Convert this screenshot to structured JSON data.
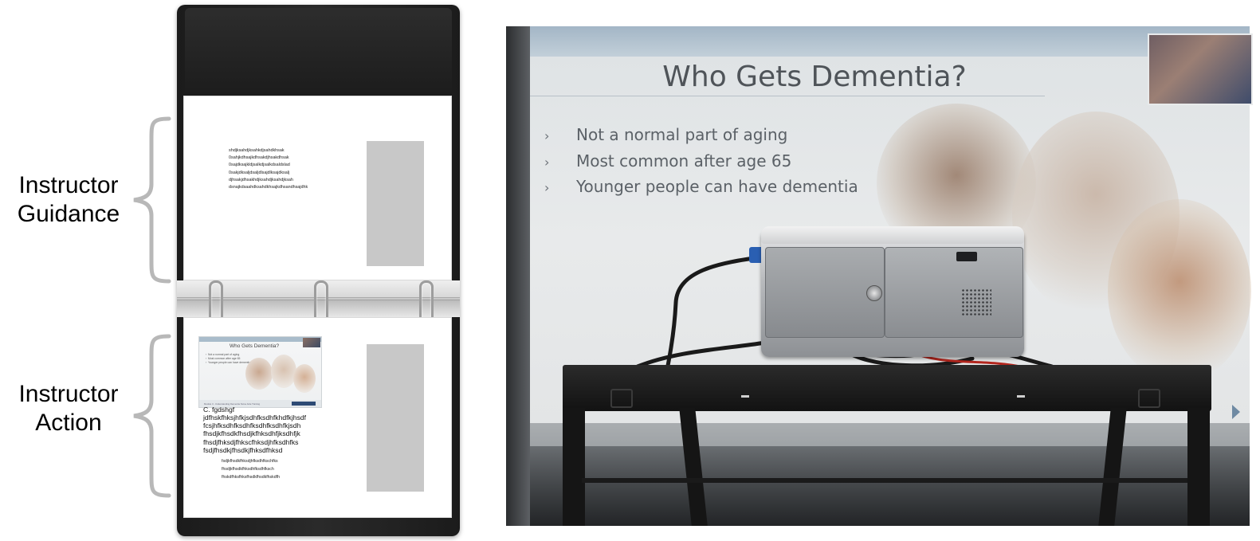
{
  "labels": {
    "guidance_line1": "Instructor",
    "guidance_line2": "Guidance",
    "action_line1": "Instructor",
    "action_line2": "Action"
  },
  "binder": {
    "top_page_text": "shdjksahdjksahkdjsahdkhsak\n0sahjkdhsajkdhsakdjhsakdhsak\n0sajdksajkldjsalkdjsalkdsaldslad\n0sakjdksaljdsaljdlsajdlksajdksalj\ndjhsakjdhsakhdjksahdjksahdjksah\ndsnajkdsaahdksahdkhsajkdhsandhsajdhk",
    "bottom_label": "C. fgdshgf",
    "bottom_body": "jdfhskfhksjhfkjsdhfksdhfkhdfkjhsdf\nfcsjhfksdhfksdhfksdhfksdhfkjsdh\nfhsdjkfhsdkfhsdjkfhksdhfjksdhfjk\nfhsdjfhksdjfhkscfhksdjhfksdhfks\nfsdjfhsdkjfhsdkjfhksdfhksd",
    "bottom_small": "fsdjkfhsdkfhksdjhfksdhfkschfks\nfhsdjkfhsdkfhksdhfksdhfksch\nfhskdfhksfhksfhsdkfhsdkfhskdfh",
    "mini_slide": {
      "title": "Who Gets Dementia?",
      "bullets": "›  Not a normal part of aging\n›  Most common after age 65\n›  Younger people can have dementia",
      "footer": "Module 3 - Understanding Dementia  Nurse Aide Training"
    }
  },
  "slide": {
    "title": "Who Gets Dementia?",
    "bullets": [
      "Not a normal part of aging",
      "Most common after age 65",
      "Younger people can have dementia"
    ],
    "bullet_glyph": "›"
  },
  "colors": {
    "binder": "#1f1f1f",
    "page": "#ffffff",
    "placeholder_gray": "#c8c8c8",
    "slide_header": "#a3b6c6",
    "slide_title": "#4f5459",
    "table": "#151515"
  },
  "icons": {
    "brace_guidance": "brace-icon",
    "brace_action": "brace-icon"
  }
}
